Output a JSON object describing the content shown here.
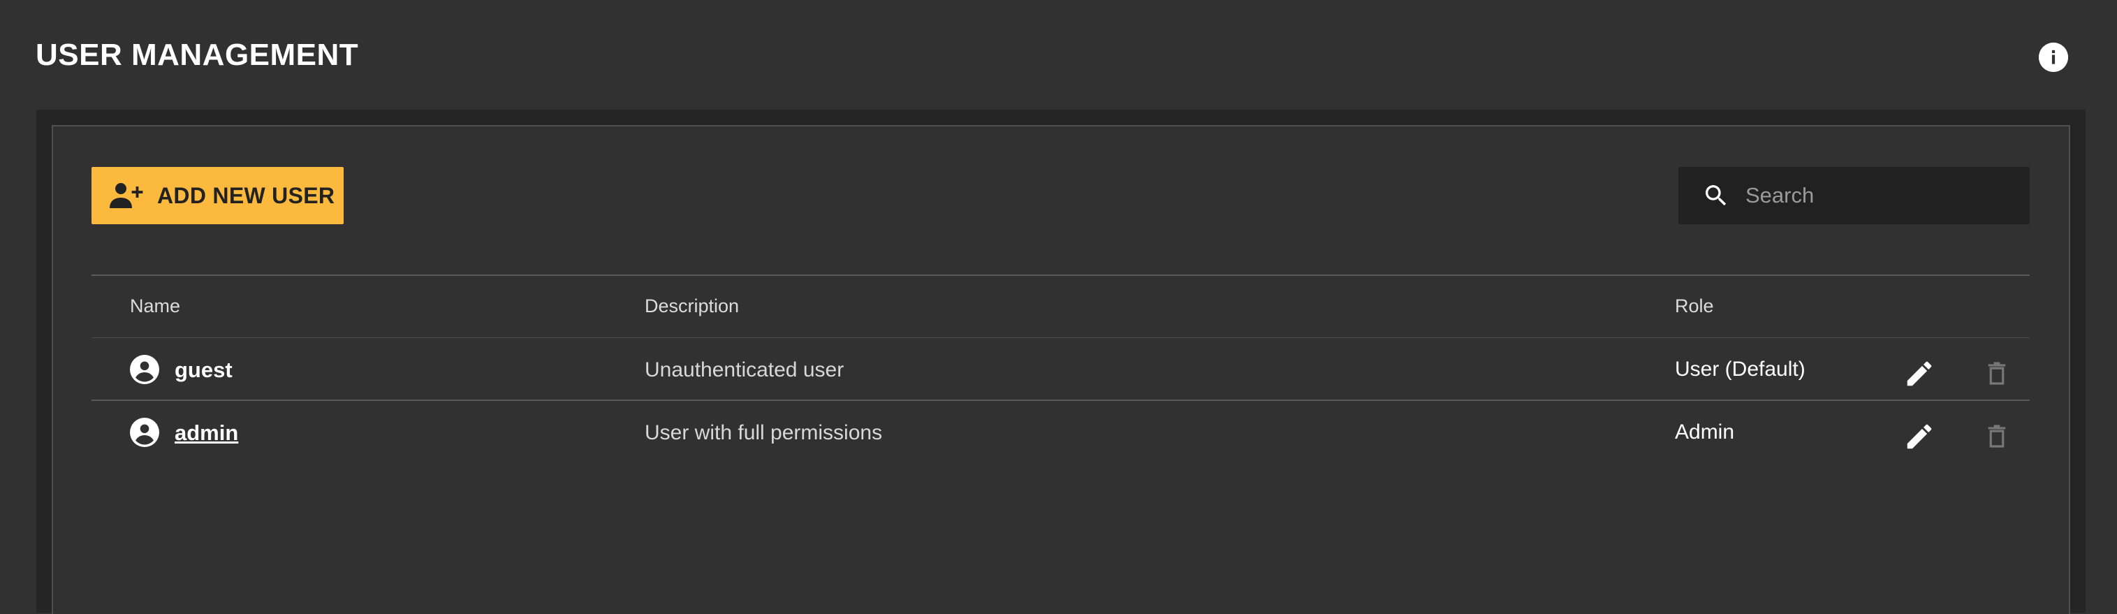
{
  "page": {
    "title": "USER MANAGEMENT",
    "info_icon": "info-icon"
  },
  "toolbar": {
    "add_user_label": "ADD NEW USER",
    "add_user_icon": "person-add-icon",
    "search": {
      "placeholder": "Search",
      "value": "",
      "icon": "search-icon"
    }
  },
  "table": {
    "columns": [
      "Name",
      "Description",
      "Role"
    ],
    "rows": [
      {
        "name": "guest",
        "description": "Unauthenticated user",
        "role": "User (Default)",
        "avatar_icon": "account-circle-icon",
        "edit_icon": "pencil-icon",
        "delete_icon": "trash-icon",
        "delete_enabled": false
      },
      {
        "name": "admin",
        "description": "User with full permissions",
        "role": "Admin",
        "avatar_icon": "account-circle-icon",
        "edit_icon": "pencil-icon",
        "delete_icon": "trash-icon",
        "delete_enabled": false
      }
    ]
  },
  "colors": {
    "background": "#313131",
    "panel": "#252525",
    "accent": "#fbb93d",
    "search_background": "#212121",
    "disabled_icon": "#777777"
  }
}
